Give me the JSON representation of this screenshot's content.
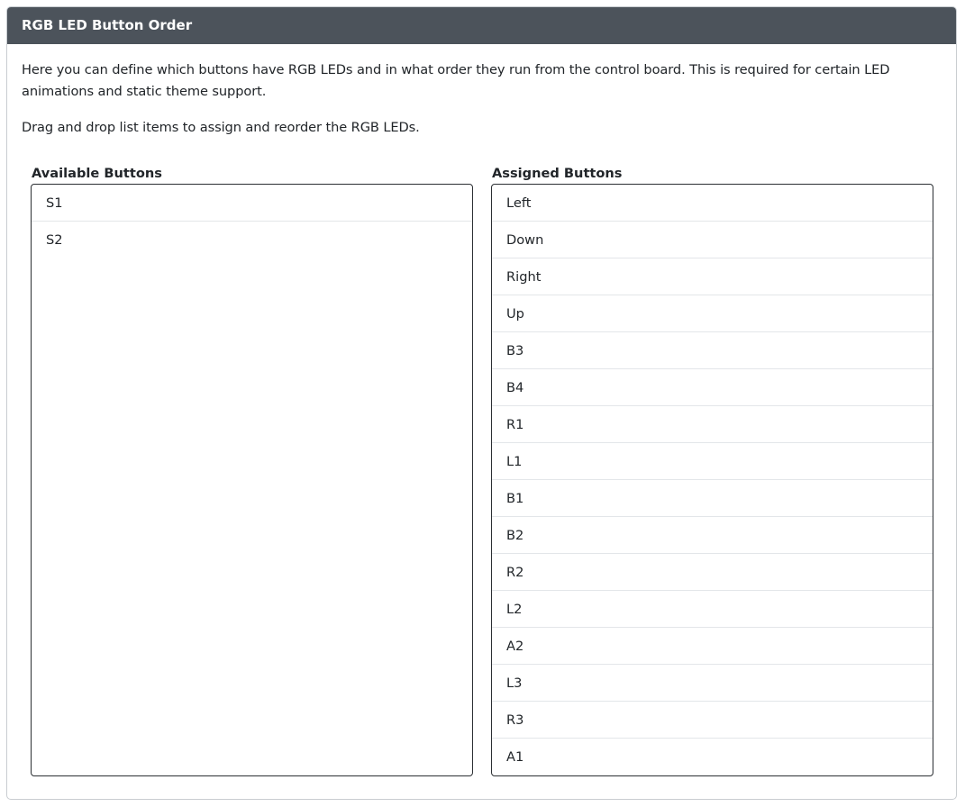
{
  "panel": {
    "title": "RGB LED Button Order",
    "description": "Here you can define which buttons have RGB LEDs and in what order they run from the control board. This is required for certain LED animations and static theme support.",
    "instructions": "Drag and drop list items to assign and reorder the RGB LEDs."
  },
  "available": {
    "title": "Available Buttons",
    "items": [
      "S1",
      "S2"
    ]
  },
  "assigned": {
    "title": "Assigned Buttons",
    "items": [
      "Left",
      "Down",
      "Right",
      "Up",
      "B3",
      "B4",
      "R1",
      "L1",
      "B1",
      "B2",
      "R2",
      "L2",
      "A2",
      "L3",
      "R3",
      "A1"
    ]
  },
  "colors": {
    "header_bg": "#4c535b",
    "header_text": "#ffffff",
    "list_border": "#2b2f33",
    "item_divider": "#e3e6e9"
  }
}
